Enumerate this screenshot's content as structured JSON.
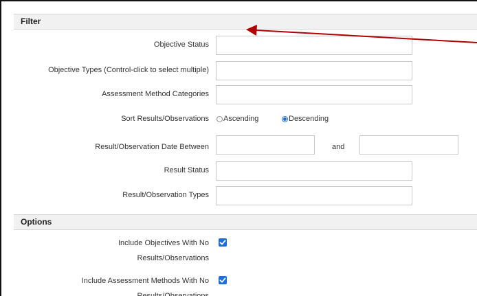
{
  "filter": {
    "header": "Filter",
    "objective_status": {
      "label": "Objective Status",
      "value": ""
    },
    "objective_types": {
      "label": "Objective Types (Control-click to select multiple)",
      "value": ""
    },
    "assessment_method_categories": {
      "label": "Assessment Method Categories",
      "value": ""
    },
    "sort": {
      "label": "Sort Results/Observations",
      "ascending_label": "Ascending",
      "descending_label": "Descending",
      "selected": "Descending"
    },
    "date_between": {
      "label": "Result/Observation Date Between",
      "from_value": "",
      "and_label": "and",
      "to_value": ""
    },
    "result_status": {
      "label": "Result Status",
      "value": ""
    },
    "result_types": {
      "label": "Result/Observation Types",
      "value": ""
    }
  },
  "options": {
    "header": "Options",
    "include_objectives": {
      "label": "Include Objectives With No Results/Observations",
      "checked": true
    },
    "include_assessment_methods": {
      "label": "Include Assessment Methods With No Results/Observations",
      "checked": true
    }
  },
  "colors": {
    "accent": "#1e6fd9",
    "annotation_arrow": "#b00000"
  }
}
